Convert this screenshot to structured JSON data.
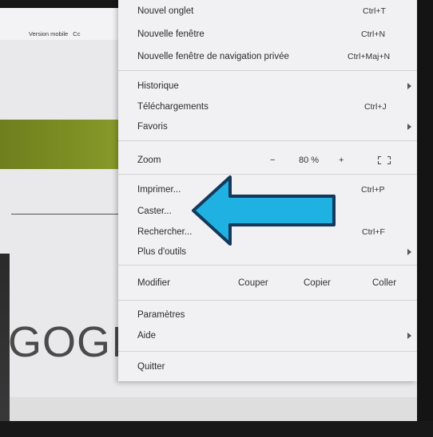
{
  "background_page": {
    "version_mobile": "Version mobile",
    "version_mobile_cut": "Cc",
    "big_text": "GOGIC"
  },
  "menu": {
    "new_tab": {
      "label": "Nouvel onglet",
      "shortcut": "Ctrl+T"
    },
    "new_window": {
      "label": "Nouvelle fenêtre",
      "shortcut": "Ctrl+N"
    },
    "new_private": {
      "label": "Nouvelle fenêtre de navigation privée",
      "shortcut": "Ctrl+Maj+N"
    },
    "history": {
      "label": "Historique"
    },
    "downloads": {
      "label": "Téléchargements",
      "shortcut": "Ctrl+J"
    },
    "bookmarks": {
      "label": "Favoris"
    },
    "zoom": {
      "label": "Zoom",
      "minus": "−",
      "level": "80 %",
      "plus": "+"
    },
    "print": {
      "label": "Imprimer...",
      "shortcut": "Ctrl+P"
    },
    "cast": {
      "label": "Caster..."
    },
    "find": {
      "label": "Rechercher...",
      "shortcut": "Ctrl+F"
    },
    "more_tools": {
      "label": "Plus d'outils"
    },
    "edit": {
      "label": "Modifier",
      "cut": "Couper",
      "copy": "Copier",
      "paste": "Coller"
    },
    "settings": {
      "label": "Paramètres"
    },
    "help": {
      "label": "Aide"
    },
    "quit": {
      "label": "Quitter"
    }
  },
  "colors": {
    "menu_bg": "#f1f1f4",
    "arrow_fill": "#1fb1e1",
    "arrow_stroke": "#14395a",
    "olive_band": "#7c8e22"
  },
  "icons": {
    "submenu": "chevron-right-icon",
    "fullscreen": "fullscreen-icon",
    "annotation": "pointing-arrow-icon"
  }
}
